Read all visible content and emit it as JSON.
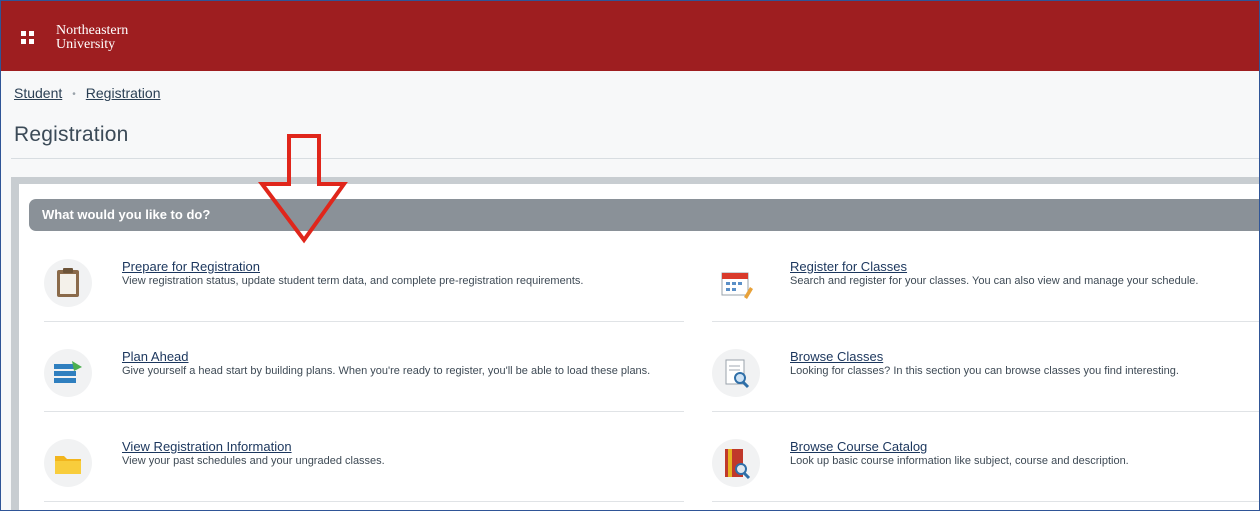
{
  "header": {
    "logo_line1": "Northeastern",
    "logo_line2": "University",
    "bg_color": "#9e1e20"
  },
  "breadcrumb": {
    "items": [
      "Student",
      "Registration"
    ],
    "separator": "•"
  },
  "page": {
    "title": "Registration"
  },
  "panel": {
    "heading": "What would you like to do?",
    "items": [
      {
        "icon": "clipboard-icon",
        "title": "Prepare for Registration",
        "description": "View registration status, update student term data, and complete pre-registration requirements."
      },
      {
        "icon": "calendar-pencil-icon",
        "title": "Register for Classes",
        "description": "Search and register for your classes. You can also view and manage your schedule."
      },
      {
        "icon": "stacked-plans-icon",
        "title": "Plan Ahead",
        "description": "Give yourself a head start by building plans. When you're ready to register, you'll be able to load these plans."
      },
      {
        "icon": "document-search-icon",
        "title": "Browse Classes",
        "description": "Looking for classes? In this section you can browse classes you find interesting."
      },
      {
        "icon": "folder-icon",
        "title": "View Registration Information",
        "description": "View your past schedules and your ungraded classes."
      },
      {
        "icon": "book-search-icon",
        "title": "Browse Course Catalog",
        "description": "Look up basic course information like subject, course and description."
      }
    ]
  },
  "annotation": {
    "arrow_color": "#e0261b"
  }
}
